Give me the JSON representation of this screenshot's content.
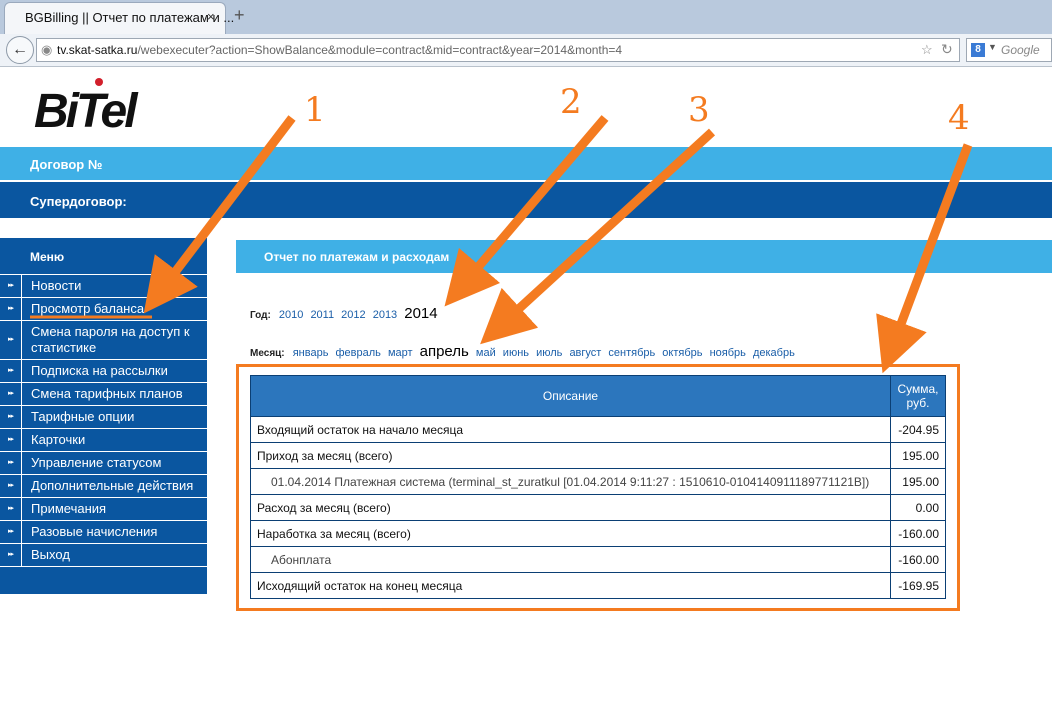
{
  "browser": {
    "tab_title": "BGBilling || Отчет по платежам и ...",
    "tab_close": "×",
    "new_tab": "+",
    "back": "←",
    "url_host": "tv.skat-satka.ru",
    "url_path": "/webexecuter?action=ShowBalance&module=contract&mid=contract&year=2014&month=4",
    "search_placeholder": "Google",
    "search_engine_letter": "8"
  },
  "logo": "BiTel",
  "header": {
    "contract_label": "Договор №",
    "supercontract_label": "Супердоговор:"
  },
  "menu": {
    "title": "Меню",
    "items": [
      {
        "label": "Новости"
      },
      {
        "label": "Просмотр баланса"
      },
      {
        "label": "Смена пароля на доступ к статистике"
      },
      {
        "label": "Подписка на рассылки"
      },
      {
        "label": "Смена тарифных планов"
      },
      {
        "label": "Тарифные опции"
      },
      {
        "label": "Карточки"
      },
      {
        "label": "Управление статусом"
      },
      {
        "label": "Дополнительные действия"
      },
      {
        "label": "Примечания"
      },
      {
        "label": "Разовые начисления"
      },
      {
        "label": "Выход"
      }
    ]
  },
  "report": {
    "title": "Отчет по платежам и расходам",
    "year_label": "Год:",
    "years": [
      "2010",
      "2011",
      "2012",
      "2013"
    ],
    "current_year": "2014",
    "month_label": "Месяц:",
    "months_before": [
      "январь",
      "февраль",
      "март"
    ],
    "current_month": "апрель",
    "months_after": [
      "май",
      "июнь",
      "июль",
      "август",
      "сентябрь",
      "октябрь",
      "ноябрь",
      "декабрь"
    ],
    "table": {
      "col_description": "Описание",
      "col_sum": "Сумма, руб.",
      "rows": [
        {
          "desc": "Входящий остаток на начало месяца",
          "sum": "-204.95"
        },
        {
          "desc": "Приход за месяц (всего)",
          "sum": "195.00"
        },
        {
          "desc": "01.04.2014 Платежная система (terminal_st_zuratkul [01.04.2014 9:11:27 : 1510610-0104140911189771121B])",
          "sum": "195.00"
        },
        {
          "desc": "Расход за месяц (всего)",
          "sum": "0.00"
        },
        {
          "desc": "Наработка за месяц (всего)",
          "sum": "-160.00"
        },
        {
          "desc": "Абонплата",
          "sum": "-160.00"
        },
        {
          "desc": "Исходящий остаток на конец месяца",
          "sum": "-169.95"
        }
      ]
    }
  },
  "annotations": [
    "1",
    "2",
    "3",
    "4"
  ],
  "colors": {
    "accent_light": "#3fb0e6",
    "accent_dark": "#0a56a0",
    "annotation_orange": "#f47b20"
  }
}
